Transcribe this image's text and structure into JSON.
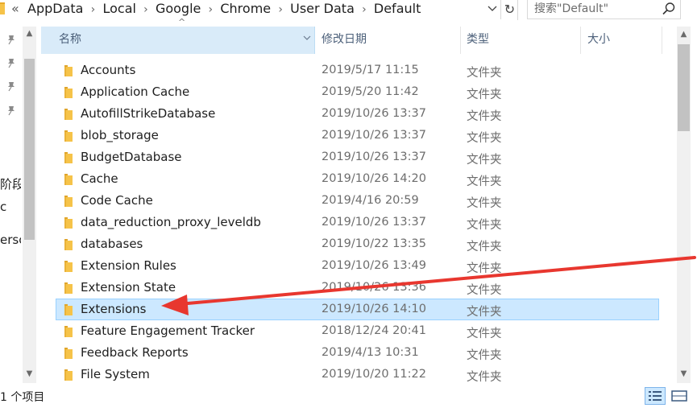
{
  "address": {
    "overflow_label": "«",
    "crumbs": [
      "AppData",
      "Local",
      "Google",
      "Chrome",
      "User Data",
      "Default"
    ],
    "dropdown_glyph": "⌄",
    "refresh_glyph": "↻"
  },
  "search": {
    "placeholder": "搜索\"Default\""
  },
  "nav": {
    "partial_labels": [
      "阶段",
      "c",
      "ersc"
    ]
  },
  "columns": {
    "name": "名称",
    "date": "修改日期",
    "type": "类型",
    "size": "大小",
    "sort_arrow": "^"
  },
  "files": [
    {
      "name": "Accounts",
      "date": "2019/5/17 11:15",
      "type": "文件夹"
    },
    {
      "name": "Application Cache",
      "date": "2019/5/20 11:42",
      "type": "文件夹"
    },
    {
      "name": "AutofillStrikeDatabase",
      "date": "2019/10/26 13:37",
      "type": "文件夹"
    },
    {
      "name": "blob_storage",
      "date": "2019/10/26 13:37",
      "type": "文件夹"
    },
    {
      "name": "BudgetDatabase",
      "date": "2019/10/26 13:37",
      "type": "文件夹"
    },
    {
      "name": "Cache",
      "date": "2019/10/26 14:20",
      "type": "文件夹"
    },
    {
      "name": "Code Cache",
      "date": "2019/4/16 20:59",
      "type": "文件夹"
    },
    {
      "name": "data_reduction_proxy_leveldb",
      "date": "2019/10/26 13:37",
      "type": "文件夹"
    },
    {
      "name": "databases",
      "date": "2019/10/22 13:35",
      "type": "文件夹"
    },
    {
      "name": "Extension Rules",
      "date": "2019/10/26 13:49",
      "type": "文件夹"
    },
    {
      "name": "Extension State",
      "date": "2019/10/26 13:36",
      "type": "文件夹"
    },
    {
      "name": "Extensions",
      "date": "2019/10/26 14:10",
      "type": "文件夹",
      "selected": true
    },
    {
      "name": "Feature Engagement Tracker",
      "date": "2018/12/24 20:41",
      "type": "文件夹"
    },
    {
      "name": "Feedback Reports",
      "date": "2019/4/13 10:31",
      "type": "文件夹"
    },
    {
      "name": "File System",
      "date": "2019/10/20 11:22",
      "type": "文件夹"
    }
  ],
  "status": {
    "item_count": "1 个项目"
  },
  "colors": {
    "selection": "#cce8ff",
    "selection_border": "#99d1ff",
    "folder": "#f6c349",
    "annotation_arrow": "#e8372f"
  }
}
